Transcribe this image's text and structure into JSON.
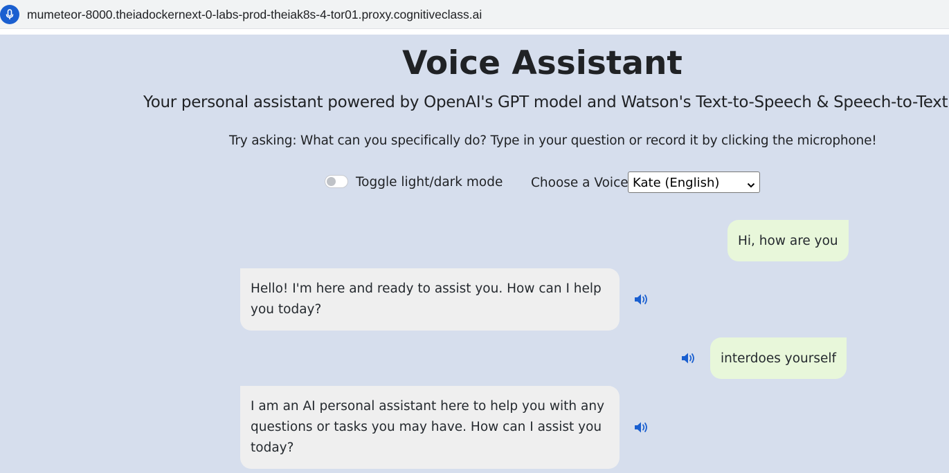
{
  "browser": {
    "url": "mumeteor-8000.theiadockernext-0-labs-prod-theiak8s-4-tor01.proxy.cognitiveclass.ai",
    "site_icon": "microphone-icon"
  },
  "header": {
    "title": "Voice Assistant",
    "subtitle": "Your personal assistant powered by OpenAI's GPT model and Watson's Text-to-Speech & Speech-to-Text",
    "hint": "Try asking: What can you specifically do? Type in your question or record it by clicking the microphone!"
  },
  "controls": {
    "toggle_label": "Toggle light/dark mode",
    "toggle_on": false,
    "voice_label": "Choose a Voice",
    "voice_selected": "Kate (English)"
  },
  "chat": {
    "messages": [
      {
        "role": "user",
        "text": "Hi, how are you"
      },
      {
        "role": "bot",
        "text": "Hello! I'm here and ready to assist you. How can I help you today?",
        "speaker_icon": "speaker-icon"
      },
      {
        "role": "user",
        "text": "interdoes yourself",
        "speaker_icon": "speaker-icon"
      },
      {
        "role": "bot",
        "text": "I am an AI personal assistant here to help you with any questions or tasks you may have. How can I assist you today?",
        "speaker_icon": "speaker-icon"
      }
    ]
  },
  "colors": {
    "page_background": "#d6deed",
    "user_bubble": "#e8f7da",
    "bot_bubble": "#efefef",
    "speaker_icon": "#1a5fd0"
  }
}
